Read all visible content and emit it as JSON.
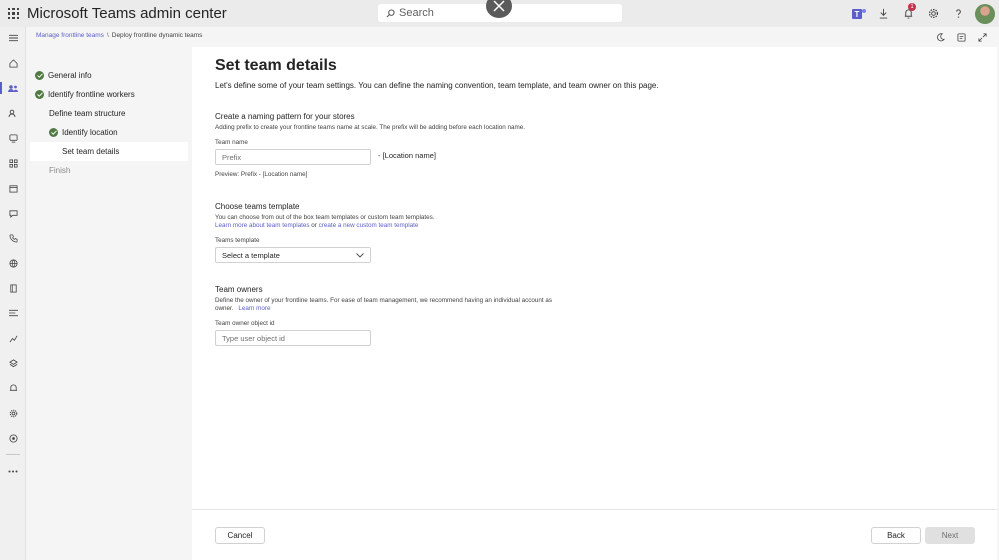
{
  "app": {
    "title": "Microsoft Teams admin center"
  },
  "search": {
    "placeholder": "Search"
  },
  "notifications": {
    "count": "1"
  },
  "breadcrumb": {
    "parent": "Manage frontline teams",
    "separator": "\\",
    "current": "Deploy frontline dynamic teams"
  },
  "steps": [
    {
      "label": "General info",
      "status": "complete"
    },
    {
      "label": "Identify frontline workers",
      "status": "complete"
    },
    {
      "label": "Define team structure",
      "status": "section"
    },
    {
      "label": "Identify location",
      "status": "complete"
    },
    {
      "label": "Set team details",
      "status": "current"
    },
    {
      "label": "Finish",
      "status": "pending"
    }
  ],
  "page": {
    "title": "Set team details",
    "intro": "Let's define some of your team settings. You can define the naming convention, team template, and team owner on this page."
  },
  "naming": {
    "title": "Create a naming pattern for your stores",
    "description": "Adding prefix to create your frontline teams name at scale. The prefix will be adding before each location name.",
    "field_label": "Team name",
    "placeholder": "Prefix",
    "suffix": "- [Location name]",
    "preview": "Preview: Prefix - [Location name]"
  },
  "template": {
    "title": "Choose teams template",
    "description": "You can choose from out of the box team templates or custom team templates.",
    "learn_more": "Learn more about team templates",
    "or_text": "or",
    "create_link": "create a new custom team template",
    "field_label": "Teams template",
    "selected": "Select a template"
  },
  "owners": {
    "title": "Team owners",
    "description_line1": "Define the owner of your frontline teams. For ease of team management, we recommend having an individual account as",
    "description_line2": "owner.",
    "learn_more": "Learn more",
    "field_label": "Team owner object id",
    "placeholder": "Type user object id"
  },
  "footer": {
    "cancel": "Cancel",
    "back": "Back",
    "next": "Next"
  }
}
